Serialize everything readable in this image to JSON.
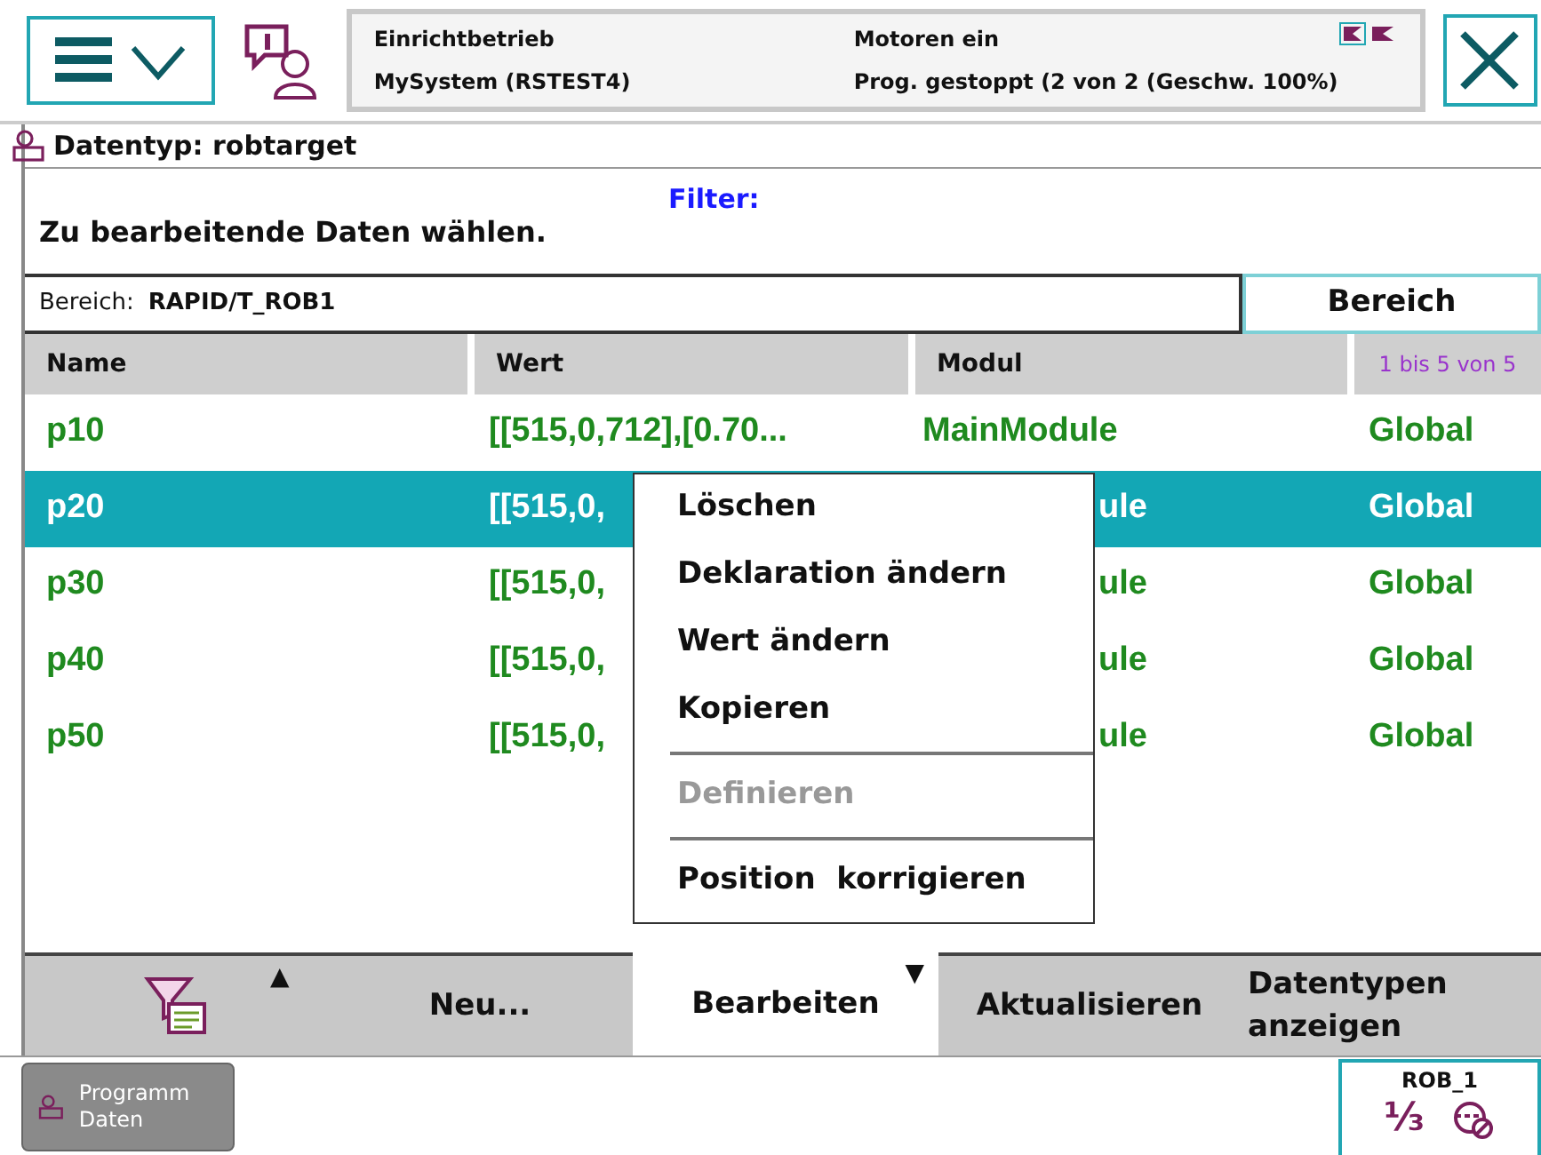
{
  "header": {
    "status": [
      [
        "Einrichtbetrieb",
        "MySystem (RSTEST4)"
      ],
      [
        "Motoren ein",
        "Prog. gestoppt (2 von 2 (Geschw. 100%)"
      ]
    ]
  },
  "datatype": "Datentyp: robtarget",
  "filter": {
    "label": "Filter:"
  },
  "instruction": "Zu bearbeitende Daten wählen.",
  "scope": {
    "label": "Bereich:",
    "value": "RAPID/T_ROB1",
    "button": "Bereich"
  },
  "table": {
    "columns": [
      "Name",
      "Wert",
      "Modul"
    ],
    "count": "1 bis 5 von 5",
    "rows": [
      {
        "name": "p10",
        "value": "[[515,0,712],[0.70...",
        "module": "MainModule",
        "scope": "Global",
        "selected": false
      },
      {
        "name": "p20",
        "value": "[[515,0,",
        "module": "ule",
        "scope": "Global",
        "selected": true
      },
      {
        "name": "p30",
        "value": "[[515,0,",
        "module": "ule",
        "scope": "Global",
        "selected": false
      },
      {
        "name": "p40",
        "value": "[[515,0,",
        "module": "ule",
        "scope": "Global",
        "selected": false
      },
      {
        "name": "p50",
        "value": "[[515,0,",
        "module": "ule",
        "scope": "Global",
        "selected": false
      }
    ]
  },
  "context_menu": {
    "groups": [
      [
        {
          "label": "Löschen",
          "disabled": false
        },
        {
          "label": "Deklaration ändern",
          "disabled": false
        },
        {
          "label": "Wert ändern",
          "disabled": false
        },
        {
          "label": "Kopieren",
          "disabled": false
        }
      ],
      [
        {
          "label": "Definieren",
          "disabled": true
        }
      ],
      [
        {
          "label": "Position  korrigieren",
          "disabled": false
        }
      ]
    ]
  },
  "toolbar": [
    {
      "kind": "icon",
      "caret": "▲",
      "selected": false
    },
    {
      "kind": "text",
      "label": "Neu...",
      "selected": false
    },
    {
      "kind": "text",
      "label": "Bearbeiten",
      "caret": "▼",
      "selected": true
    },
    {
      "kind": "text",
      "label": "Aktualisieren",
      "selected": false
    },
    {
      "kind": "text",
      "label": "Datentypen anzeigen",
      "selected": false
    }
  ],
  "taskbar": {
    "app": "Programm Daten",
    "quickset": {
      "label": "ROB_1",
      "speed": "⅓"
    }
  }
}
